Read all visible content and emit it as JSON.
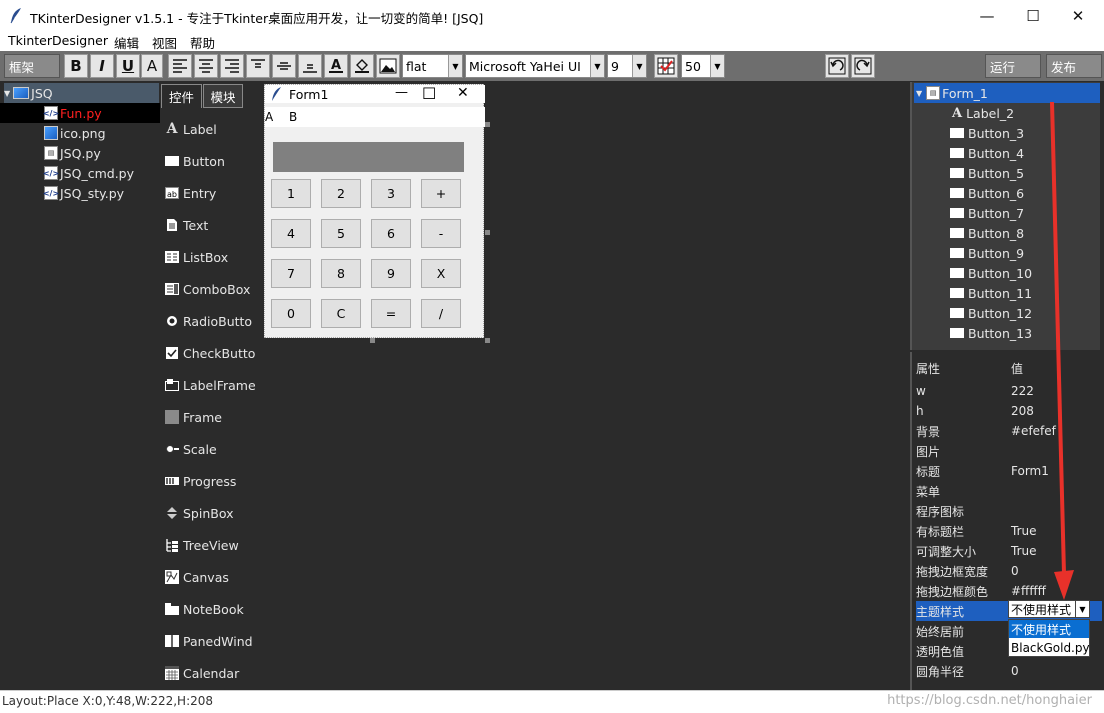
{
  "window": {
    "title": "TKinterDesigner v1.5.1 - 专注于Tkinter桌面应用开发，让一切变的简单!    [JSQ]",
    "minimize": "—",
    "maximize": "☐",
    "close": "✕"
  },
  "menubar": {
    "items": [
      "TkinterDesigner",
      "编辑",
      "视图",
      "帮助"
    ]
  },
  "toolbar": {
    "layout_label": "框架",
    "bold": "B",
    "italic": "I",
    "underline": "U",
    "font_a": "A",
    "relief_value": "flat",
    "font_value": "Microsoft YaHei UI",
    "size_value": "9",
    "grid_value": "50",
    "run_label": "运行",
    "publish_label": "发布"
  },
  "project": {
    "root": "JSQ",
    "files": [
      {
        "name": "Fun.py",
        "type": "py",
        "selected": true
      },
      {
        "name": "ico.png",
        "type": "png",
        "selected": false
      },
      {
        "name": "JSQ.py",
        "type": "sty",
        "selected": false
      },
      {
        "name": "JSQ_cmd.py",
        "type": "py",
        "selected": false
      },
      {
        "name": "JSQ_sty.py",
        "type": "py",
        "selected": false
      }
    ]
  },
  "palette": {
    "tabs": [
      "控件",
      "模块"
    ],
    "widgets": [
      {
        "label": "Label",
        "icon": "label-icon"
      },
      {
        "label": "Button",
        "icon": "button-icon"
      },
      {
        "label": "Entry",
        "icon": "entry-icon"
      },
      {
        "label": "Text",
        "icon": "text-icon"
      },
      {
        "label": "ListBox",
        "icon": "listbox-icon"
      },
      {
        "label": "ComboBox",
        "icon": "combobox-icon"
      },
      {
        "label": "RadioButto",
        "icon": "radiobutton-icon"
      },
      {
        "label": "CheckButto",
        "icon": "checkbutton-icon"
      },
      {
        "label": "LabelFrame",
        "icon": "labelframe-icon"
      },
      {
        "label": "Frame",
        "icon": "frame-icon"
      },
      {
        "label": "Scale",
        "icon": "scale-icon"
      },
      {
        "label": "Progress",
        "icon": "progress-icon"
      },
      {
        "label": "SpinBox",
        "icon": "spinbox-icon"
      },
      {
        "label": "TreeView",
        "icon": "treeview-icon"
      },
      {
        "label": "Canvas",
        "icon": "canvas-icon"
      },
      {
        "label": "NoteBook",
        "icon": "notebook-icon"
      },
      {
        "label": "PanedWind",
        "icon": "panedwindow-icon"
      },
      {
        "label": "Calendar",
        "icon": "calendar-icon"
      }
    ]
  },
  "form": {
    "title": "Form1",
    "menu": [
      "A",
      "B"
    ],
    "keys": [
      "1",
      "2",
      "3",
      "+",
      "4",
      "5",
      "6",
      "-",
      "7",
      "8",
      "9",
      "X",
      "0",
      "C",
      "=",
      "/"
    ]
  },
  "objects": {
    "root": "Form_1",
    "children": [
      "Label_2",
      "Button_3",
      "Button_4",
      "Button_5",
      "Button_6",
      "Button_7",
      "Button_8",
      "Button_9",
      "Button_10",
      "Button_11",
      "Button_12",
      "Button_13"
    ]
  },
  "properties": {
    "header_key": "属性",
    "header_value": "值",
    "rows": [
      {
        "k": "w",
        "v": "222"
      },
      {
        "k": "h",
        "v": "208"
      },
      {
        "k": "背景",
        "v": "#efefef"
      },
      {
        "k": "图片",
        "v": ""
      },
      {
        "k": "标题",
        "v": "Form1"
      },
      {
        "k": "菜单",
        "v": ""
      },
      {
        "k": "程序图标",
        "v": ""
      },
      {
        "k": "有标题栏",
        "v": "True"
      },
      {
        "k": "可调整大小",
        "v": "True"
      },
      {
        "k": "拖拽边框宽度",
        "v": "0"
      },
      {
        "k": "拖拽边框颜色",
        "v": "#ffffff"
      },
      {
        "k": "主题样式",
        "v": ""
      },
      {
        "k": "始终居前",
        "v": ""
      },
      {
        "k": "透明色值",
        "v": ""
      },
      {
        "k": "圆角半径",
        "v": "0"
      }
    ],
    "theme_selected": "不使用样式",
    "theme_options": [
      "不使用样式",
      "BlackGold.py"
    ]
  },
  "status": {
    "text": "Layout:Place  X:0,Y:48,W:222,H:208",
    "watermark": "https://blog.csdn.net/honghaier"
  },
  "colors": {
    "selection": "#1e5fbf",
    "annotation_arrow": "#e8312a",
    "selected_file": "#ff2020"
  }
}
